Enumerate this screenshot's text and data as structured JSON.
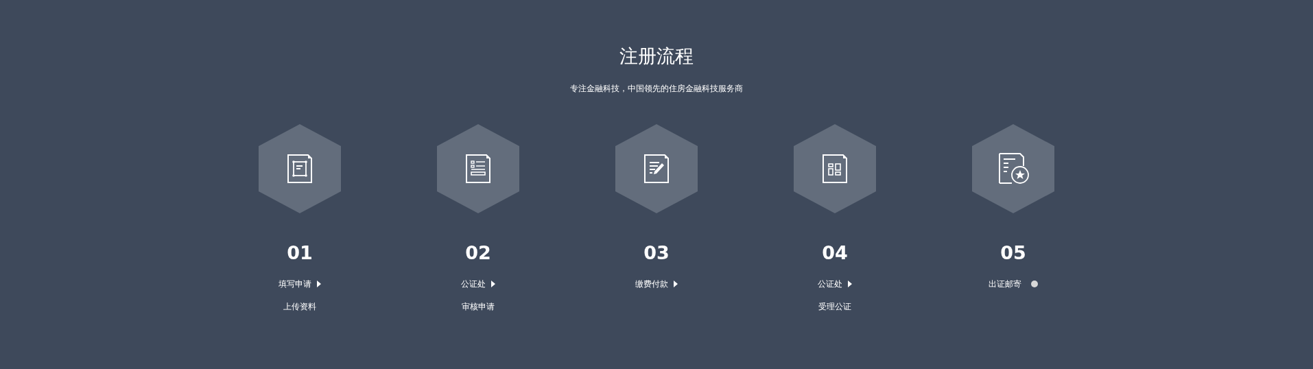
{
  "title": "注册流程",
  "subtitle": "专注金融科技，中国领先的住房金融科技服务商",
  "steps": [
    {
      "kind": "arrow",
      "number": "01",
      "label": "填写申请",
      "detail": "上传资料"
    },
    {
      "kind": "arrow",
      "number": "02",
      "label": "公证处",
      "detail": "审核申请"
    },
    {
      "kind": "arrow",
      "number": "03",
      "label": "缴费付款"
    },
    {
      "kind": "arrow",
      "number": "04",
      "label": "公证处",
      "detail": "受理公证"
    },
    {
      "kind": "dot",
      "number": "05",
      "label": "出证邮寄"
    }
  ]
}
